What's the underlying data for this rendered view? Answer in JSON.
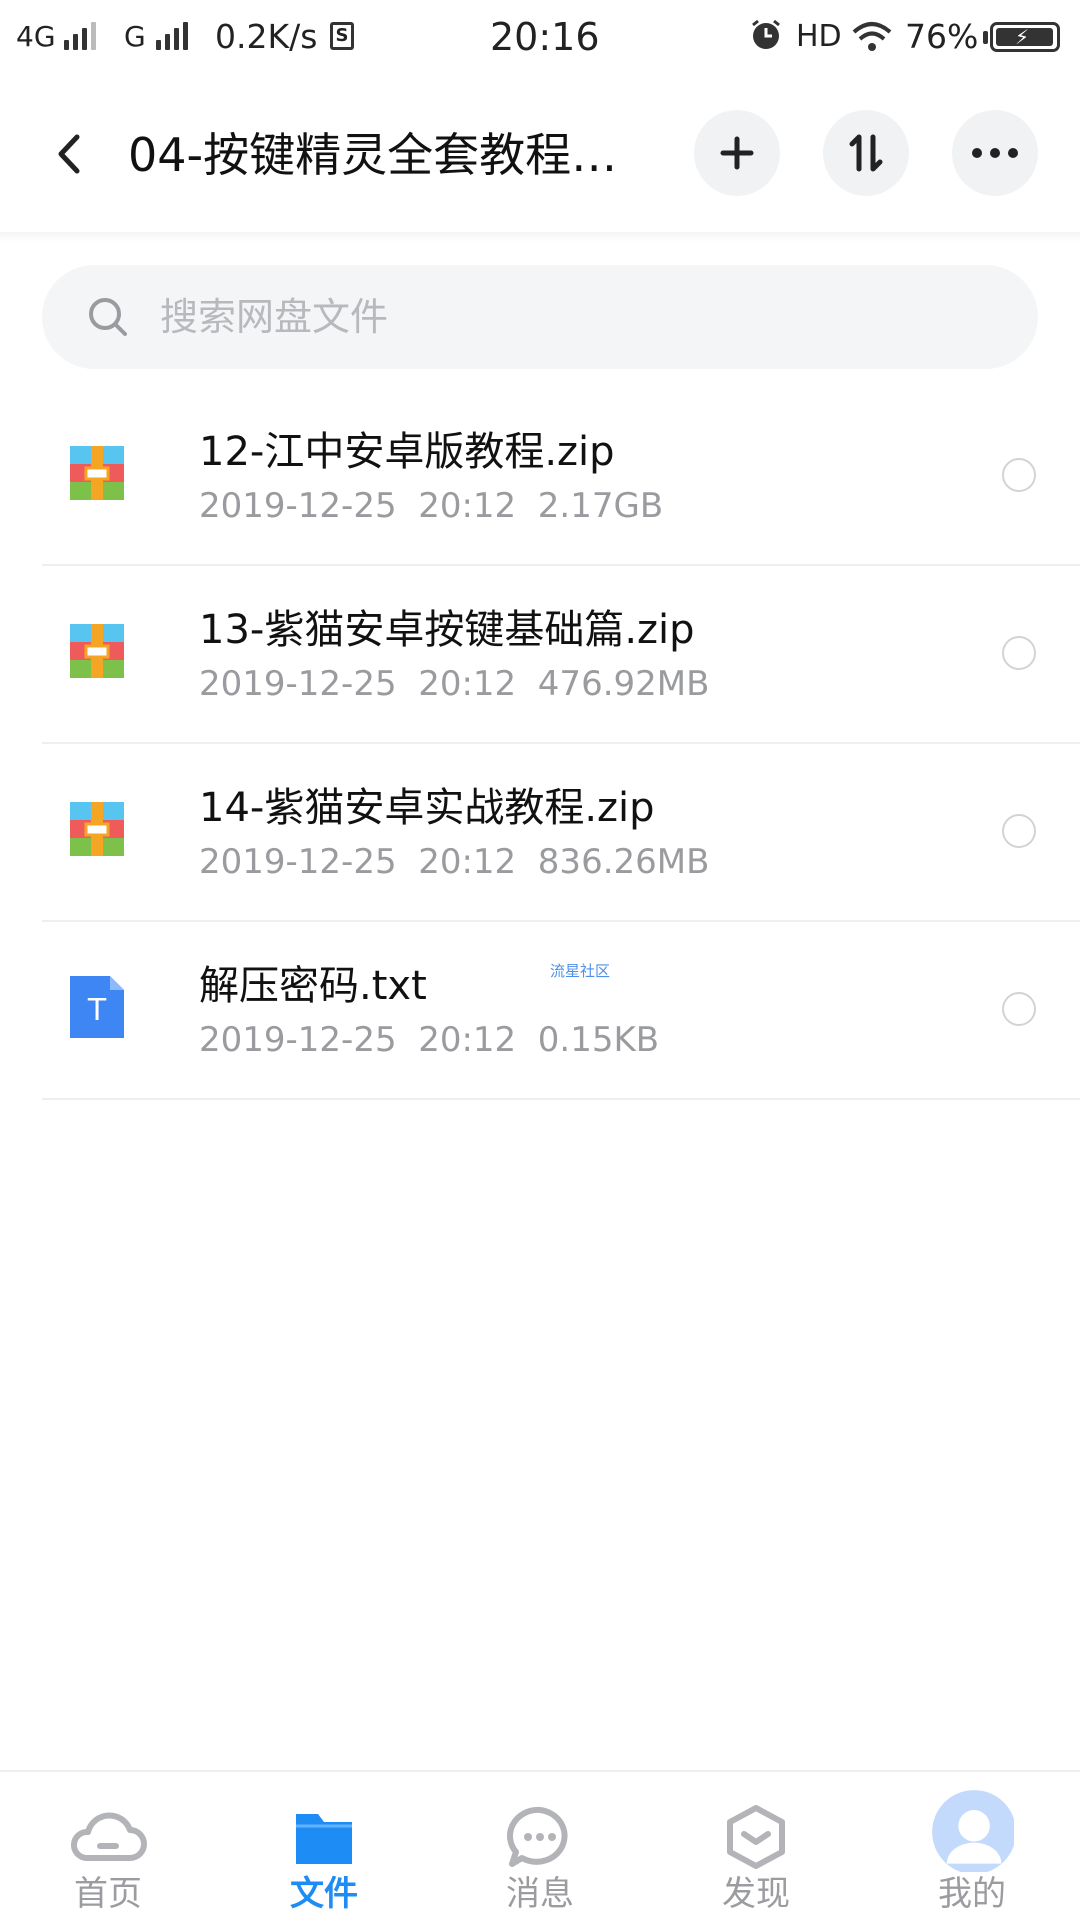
{
  "status_bar": {
    "network1": "4G",
    "network2": "G",
    "speed": "0.2K/s",
    "sim_label": "S",
    "time": "20:16",
    "hd": "HD",
    "battery": "76%"
  },
  "header": {
    "title": "04-按键精灵全套教程…",
    "back_icon": "chevron-left-icon",
    "actions": [
      {
        "name": "add",
        "icon": "plus-icon"
      },
      {
        "name": "transfer",
        "icon": "upload-download-icon"
      },
      {
        "name": "more",
        "icon": "ellipsis-icon"
      }
    ]
  },
  "search": {
    "placeholder": "搜索网盘文件"
  },
  "files": [
    {
      "name": "12-江中安卓版教程.zip",
      "meta": "2019-12-25  20:12  2.17GB",
      "type": "zip-icon"
    },
    {
      "name": "13-紫猫安卓按键基础篇.zip",
      "meta": "2019-12-25  20:12  476.92MB",
      "type": "zip-icon"
    },
    {
      "name": "14-紫猫安卓实战教程.zip",
      "meta": "2019-12-25  20:12  836.26MB",
      "type": "zip-icon"
    },
    {
      "name": "解压密码.txt",
      "meta": "2019-12-25  20:12  0.15KB",
      "type": "text-file-icon",
      "watermark": "流星社区",
      "icon_glyph": "T"
    }
  ],
  "tabs": [
    {
      "label": "首页",
      "icon": "cloud-icon",
      "active": false
    },
    {
      "label": "文件",
      "icon": "folder-icon",
      "active": true
    },
    {
      "label": "消息",
      "icon": "chat-bubble-icon",
      "active": false
    },
    {
      "label": "发现",
      "icon": "cube-icon",
      "active": false
    },
    {
      "label": "我的",
      "icon": "avatar-icon",
      "active": false
    }
  ],
  "colors": {
    "accent": "#1e8cf5",
    "inactive": "#9b9ca0",
    "zip_blue": "#58c4f0",
    "zip_red": "#ef5b5b",
    "zip_green": "#7dc04a",
    "zip_orange": "#f5a524",
    "txt_blue": "#3d86f3"
  }
}
